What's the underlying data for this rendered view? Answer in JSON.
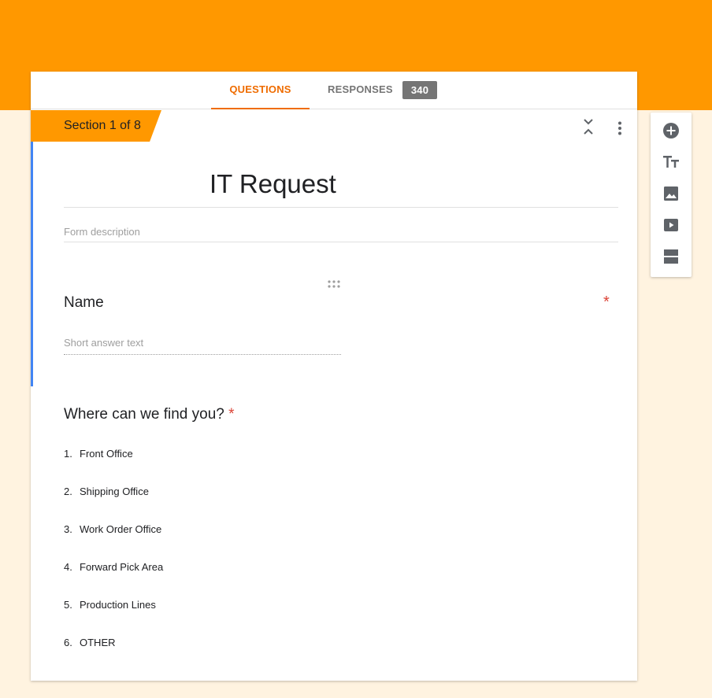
{
  "tabs": {
    "questions_label": "QUESTIONS",
    "responses_label": "RESPONSES",
    "responses_count": "340"
  },
  "section": {
    "label": "Section 1 of 8"
  },
  "form": {
    "title": "IT Request",
    "description_placeholder": "Form description"
  },
  "questions": [
    {
      "title": "Name",
      "required_mark": "*",
      "answer_placeholder": "Short answer text"
    },
    {
      "title": "Where can we find you?",
      "required_mark": "*",
      "options": [
        {
          "num": "1.",
          "label": "Front Office"
        },
        {
          "num": "2.",
          "label": "Shipping Office"
        },
        {
          "num": "3.",
          "label": "Work Order Office"
        },
        {
          "num": "4.",
          "label": "Forward Pick Area"
        },
        {
          "num": "5.",
          "label": "Production Lines"
        },
        {
          "num": "6.",
          "label": "OTHER"
        }
      ]
    }
  ],
  "toolbar": {
    "icons": [
      "add-question-icon",
      "title-text-icon",
      "image-icon",
      "video-icon",
      "section-icon"
    ]
  },
  "colors": {
    "theme": "#ff9800",
    "background": "#fff3e0",
    "tab_active": "#ef6c00",
    "focus_bar": "#4285f4",
    "required": "#db4437"
  }
}
